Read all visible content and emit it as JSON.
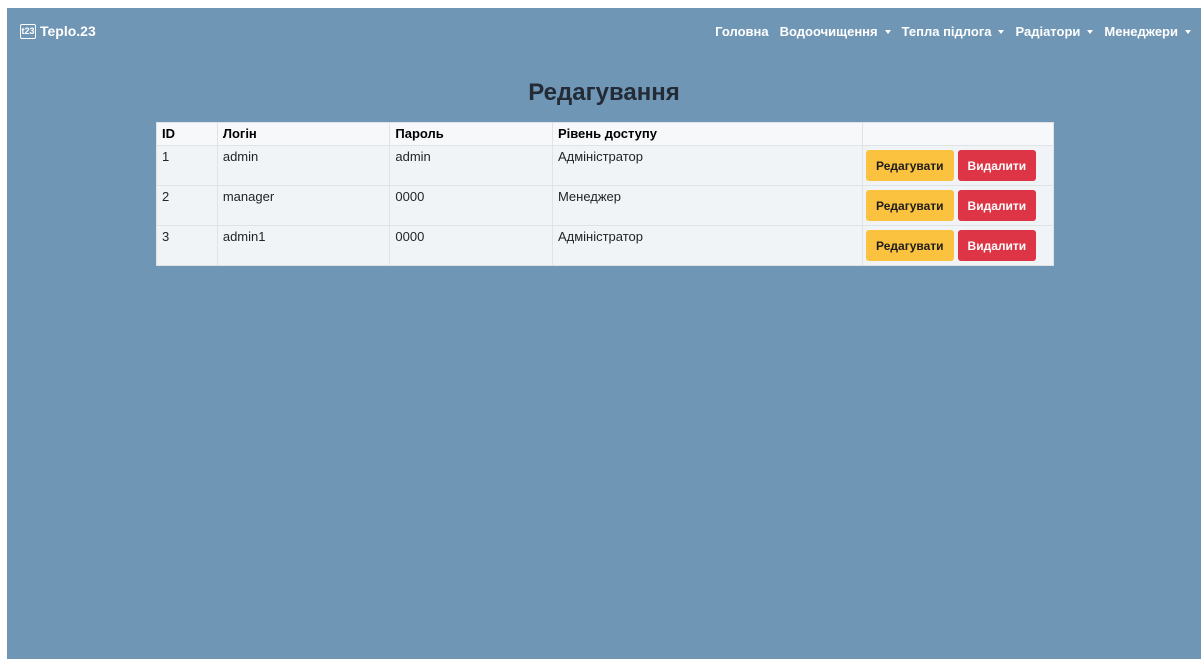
{
  "navbar": {
    "brand": {
      "logo_text": "t23",
      "name": "Teplo.23"
    },
    "links": [
      {
        "label": "Головна",
        "dropdown": false
      },
      {
        "label": "Водоочищення",
        "dropdown": true
      },
      {
        "label": "Тепла підлога",
        "dropdown": true
      },
      {
        "label": "Радіатори",
        "dropdown": true
      },
      {
        "label": "Менеджери",
        "dropdown": true
      }
    ]
  },
  "main": {
    "title": "Редагування",
    "table": {
      "headers": [
        "ID",
        "Логін",
        "Пароль",
        "Рівень доступу",
        ""
      ],
      "rows": [
        {
          "id": "1",
          "login": "admin",
          "password": "admin",
          "level": "Адміністратор"
        },
        {
          "id": "2",
          "login": "manager",
          "password": "0000",
          "level": "Менеджер"
        },
        {
          "id": "3",
          "login": "admin1",
          "password": "0000",
          "level": "Адміністратор"
        }
      ],
      "edit_label": "Редагувати",
      "delete_label": "Видалити"
    }
  },
  "colors": {
    "background": "#7096b6",
    "edit_button": "#fbc23f",
    "delete_button": "#dd3545"
  }
}
